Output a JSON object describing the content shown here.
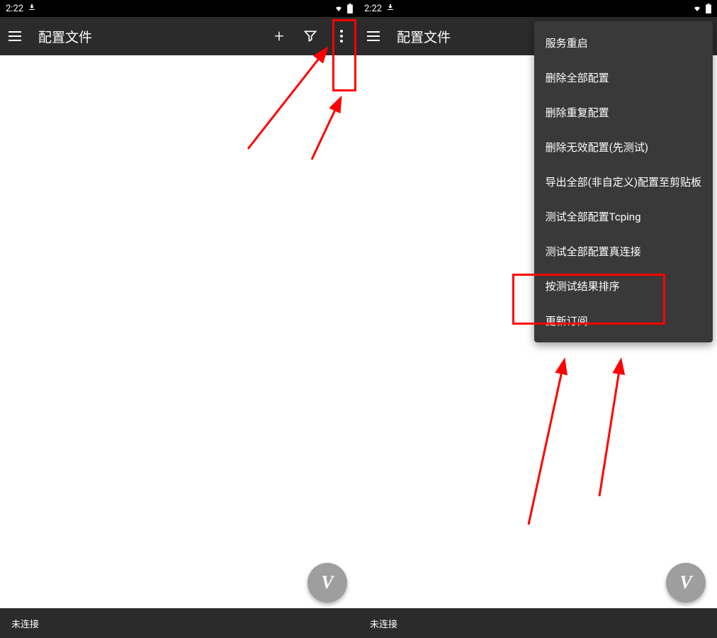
{
  "status_bar": {
    "time": "2:22"
  },
  "app_bar": {
    "title": "配置文件"
  },
  "bottom_bar": {
    "status": "未连接"
  },
  "fab": {
    "letter": "V"
  },
  "menu": {
    "items": [
      "服务重启",
      "删除全部配置",
      "删除重复配置",
      "删除无效配置(先测试)",
      "导出全部(非自定义)配置至剪贴板",
      "测试全部配置Tcping",
      "测试全部配置真连接",
      "按测试结果排序",
      "更新订阅"
    ]
  }
}
